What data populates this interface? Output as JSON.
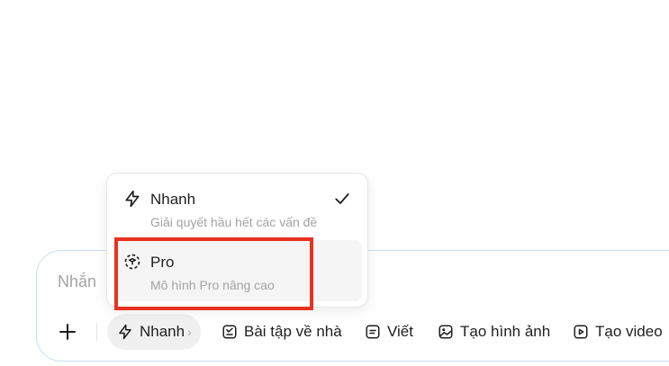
{
  "composer": {
    "placeholder": "Nhắn"
  },
  "toolbar": {
    "add_icon": "plus-icon",
    "mode_chip": {
      "icon": "lightning-icon",
      "label": "Nhanh",
      "chevron": "›"
    },
    "tools": [
      {
        "icon": "homework-icon",
        "label": "Bài tập về nhà"
      },
      {
        "icon": "write-icon",
        "label": "Viết"
      },
      {
        "icon": "image-icon",
        "label": "Tạo hình ảnh"
      },
      {
        "icon": "video-icon",
        "label": "Tạo video"
      }
    ]
  },
  "mode_menu": {
    "items": [
      {
        "icon": "lightning-icon",
        "title": "Nhanh",
        "description": "Giải quyết hầu hết các vấn đề",
        "selected": true
      },
      {
        "icon": "pro-cube-icon",
        "title": "Pro",
        "description": "Mô hình Pro nâng cao",
        "selected": false
      }
    ]
  },
  "colors": {
    "highlight": "#e8321f",
    "composer_border": "#c9dcf6",
    "muted_text": "#a3a3a3"
  }
}
